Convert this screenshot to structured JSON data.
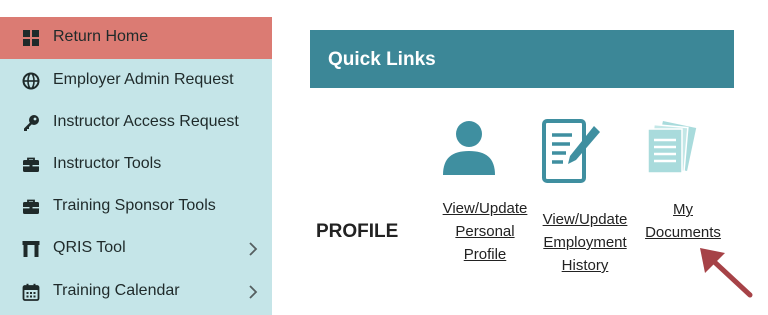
{
  "sidebar": {
    "items": [
      {
        "label": "Return Home",
        "icon": "grid-icon",
        "active": true
      },
      {
        "label": "Employer Admin Request",
        "icon": "globe-icon"
      },
      {
        "label": "Instructor Access Request",
        "icon": "key-icon"
      },
      {
        "label": "Instructor Tools",
        "icon": "toolbox-icon"
      },
      {
        "label": "Training Sponsor Tools",
        "icon": "toolbox-icon"
      },
      {
        "label": "QRIS Tool",
        "icon": "arch-icon",
        "has_submenu": true
      },
      {
        "label": "Training Calendar",
        "icon": "calendar-icon",
        "has_submenu": true
      }
    ]
  },
  "quick_links": {
    "title": "Quick Links",
    "section_label": "PROFILE",
    "links": [
      {
        "lines": [
          "View/Update",
          "Personal",
          "Profile"
        ],
        "icon": "person-icon"
      },
      {
        "lines": [
          "View/Update",
          "Employment",
          "History"
        ],
        "icon": "edit-document-icon"
      },
      {
        "lines": [
          "My",
          "Documents"
        ],
        "icon": "documents-icon"
      }
    ]
  },
  "colors": {
    "sidebar_bg": "#c5e5e8",
    "active_item": "#db7b73",
    "header_bg": "#3c8797",
    "icon_teal": "#3f8fa0",
    "icon_light_teal": "#a9dbdc",
    "arrow": "#a64247"
  }
}
